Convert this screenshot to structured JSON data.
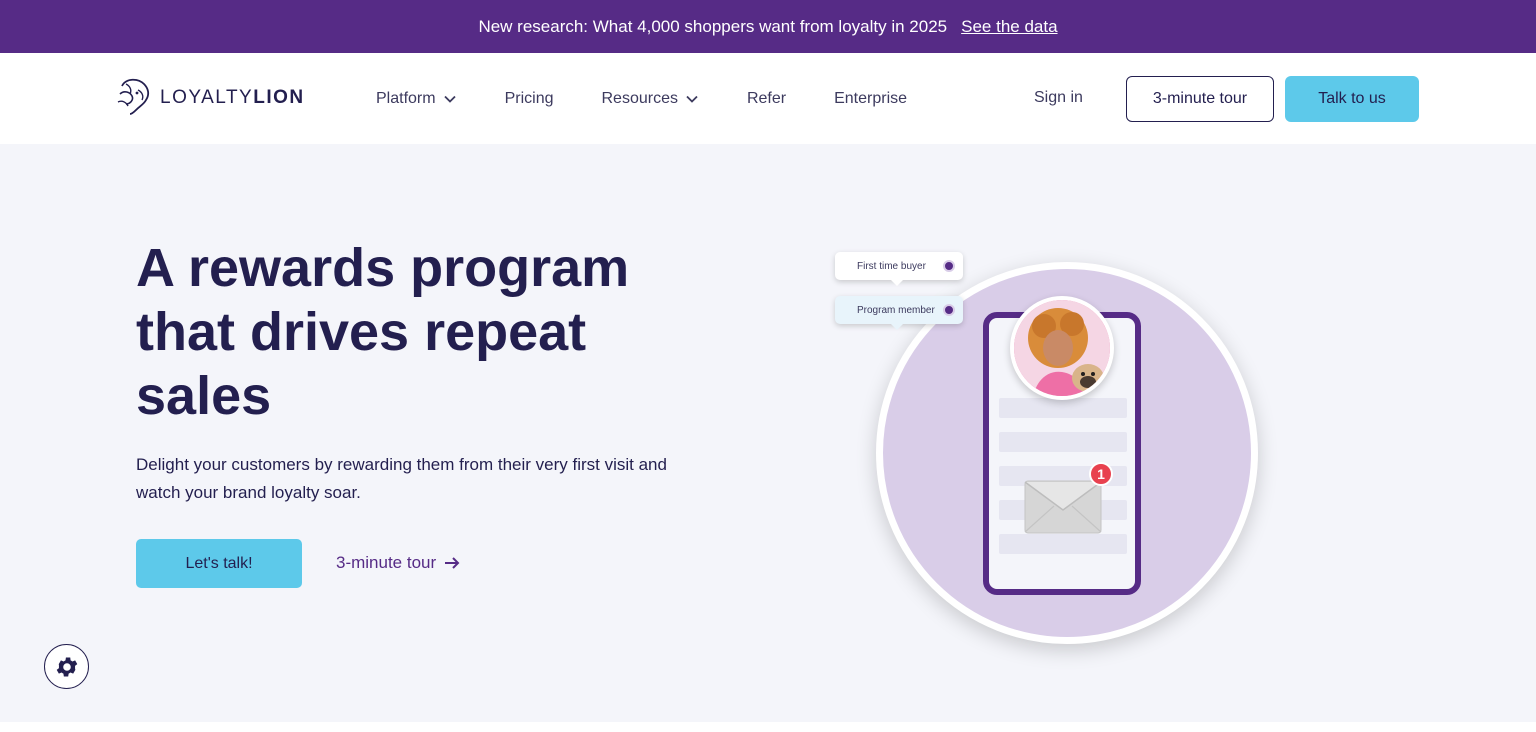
{
  "announcement": {
    "text": "New research: What 4,000 shoppers want from loyalty in 2025",
    "link_label": "See the data"
  },
  "header": {
    "logo_light": "LOYALTY",
    "logo_bold": "LION",
    "nav": [
      {
        "label": "Platform",
        "has_dropdown": true
      },
      {
        "label": "Pricing",
        "has_dropdown": false
      },
      {
        "label": "Resources",
        "has_dropdown": true
      },
      {
        "label": "Refer",
        "has_dropdown": false
      },
      {
        "label": "Enterprise",
        "has_dropdown": false
      }
    ],
    "sign_in": "Sign in",
    "tour_button": "3-minute tour",
    "talk_button": "Talk to us"
  },
  "hero": {
    "headline": "A rewards program that drives repeat sales",
    "subtext": "Delight your customers by rewarding them from their very first visit and watch your brand loyalty soar.",
    "primary_cta": "Let's talk!",
    "secondary_cta": "3-minute tour"
  },
  "illustration": {
    "tag_1": "First time buyer",
    "tag_2": "Program member",
    "notification_count": "1"
  },
  "colors": {
    "brand_purple": "#562b86",
    "accent_blue": "#5dc9ea",
    "text_dark": "#231f4f",
    "hero_bg": "#f4f5fa",
    "circle_lavender": "#d9cde8",
    "notification_red": "#e8414f"
  },
  "icons": {
    "logo": "lion-head-icon",
    "dropdown": "chevron-down-icon",
    "arrow": "arrow-right-icon",
    "settings": "gear-icon",
    "mail": "envelope-icon",
    "check": "check-circle-icon"
  }
}
